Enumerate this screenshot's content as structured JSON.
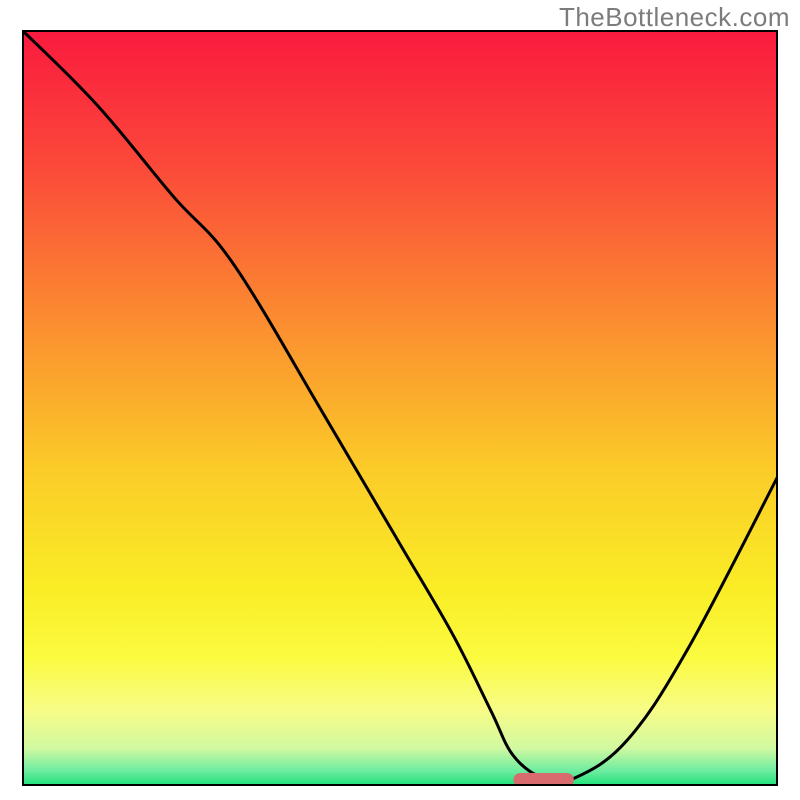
{
  "watermark": "TheBottleneck.com",
  "chart_data": {
    "type": "line",
    "title": "",
    "xlabel": "",
    "ylabel": "",
    "xlim": [
      0,
      100
    ],
    "ylim": [
      0,
      100
    ],
    "x": [
      0,
      10,
      20,
      28,
      40,
      50,
      57,
      62,
      65,
      69,
      73,
      80,
      88,
      100
    ],
    "values": [
      100,
      90,
      78,
      69,
      49,
      32,
      20,
      10,
      4,
      1,
      1,
      6,
      18,
      41
    ],
    "marker": {
      "x0": 65,
      "x1": 73,
      "y": 0.8
    },
    "gradient_stops": [
      {
        "offset": 0,
        "color": "#fa1a3e"
      },
      {
        "offset": 18,
        "color": "#fb493a"
      },
      {
        "offset": 38,
        "color": "#fb8b30"
      },
      {
        "offset": 58,
        "color": "#fbcb28"
      },
      {
        "offset": 74,
        "color": "#faed26"
      },
      {
        "offset": 83,
        "color": "#fbfb40"
      },
      {
        "offset": 90,
        "color": "#f7fc87"
      },
      {
        "offset": 95,
        "color": "#d1f9a1"
      },
      {
        "offset": 98,
        "color": "#6deca0"
      },
      {
        "offset": 100,
        "color": "#1ce178"
      }
    ]
  }
}
